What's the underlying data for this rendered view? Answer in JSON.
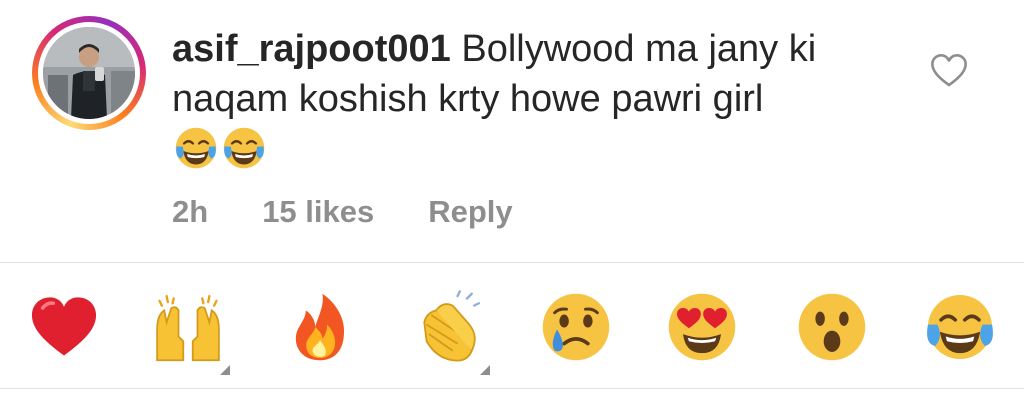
{
  "comment": {
    "username": "asif_rajpoot001",
    "text_line1": "Bollywood ma jany ki",
    "text_line2": "naqam koshish krty howe pawri girl",
    "emojis": [
      "face-with-tears-of-joy",
      "face-with-tears-of-joy"
    ],
    "time": "2h",
    "likes": "15 likes",
    "reply_label": "Reply",
    "like_icon": "heart-outline-icon"
  },
  "reactions": [
    {
      "name": "red-heart",
      "has_variants": false
    },
    {
      "name": "raising-hands",
      "has_variants": true
    },
    {
      "name": "fire",
      "has_variants": false
    },
    {
      "name": "clapping-hands",
      "has_variants": true
    },
    {
      "name": "crying-face",
      "has_variants": false
    },
    {
      "name": "heart-eyes-face",
      "has_variants": false
    },
    {
      "name": "surprised-face",
      "has_variants": false
    },
    {
      "name": "face-with-tears-of-joy",
      "has_variants": false
    }
  ],
  "colors": {
    "text": "#262626",
    "meta": "#8e8e8e",
    "divider": "#e3e3e3",
    "ring_start": "#feda75",
    "ring_mid": "#d62976",
    "ring_end": "#962fbf"
  }
}
